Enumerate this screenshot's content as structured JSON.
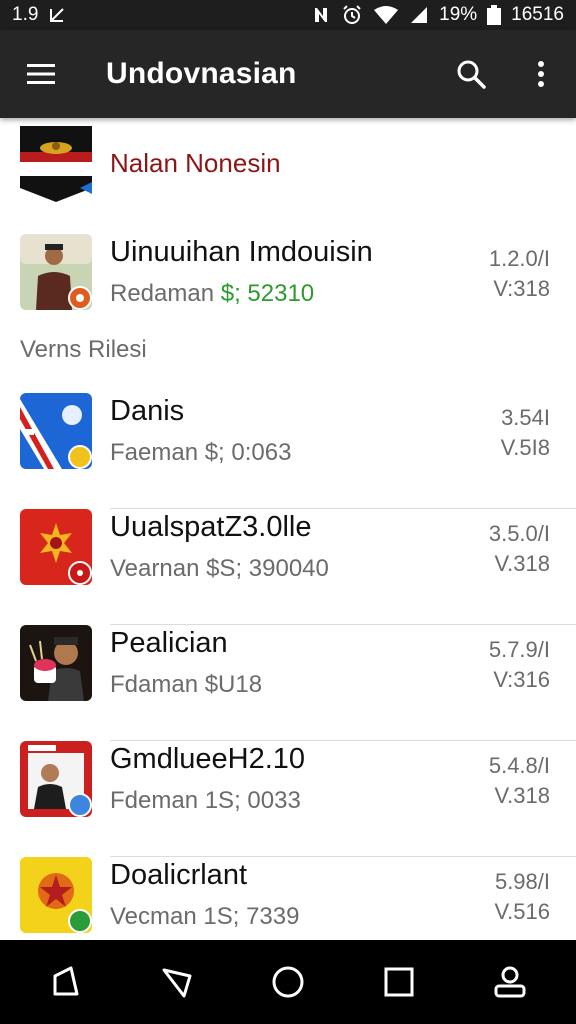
{
  "status_bar": {
    "left_text": "1.9",
    "battery_percent": "19%",
    "time": "16516"
  },
  "app_bar": {
    "title": "Undovnasian"
  },
  "featured": {
    "name": "Nalan Nonesin"
  },
  "top_app": {
    "title": "Uinuuihan Imdouisin",
    "sub_label": "Redaman",
    "sub_price": "$; 52310",
    "meta_top": "1.2.0/I",
    "meta_bottom": "V:318"
  },
  "section": {
    "label": "Verns Rilesi"
  },
  "apps": [
    {
      "title": "Danis",
      "sub": "Faeman  $; 0:063",
      "meta_top": "3.54I",
      "meta_bottom": "V.5I8"
    },
    {
      "title": "UualspatZ3.0lle",
      "sub": "Vearnan $S; 390040",
      "meta_top": "3.5.0/I",
      "meta_bottom": "V.318"
    },
    {
      "title": "Pealician",
      "sub": "Fdaman  $U18",
      "meta_top": "5.7.9/I",
      "meta_bottom": "V:316"
    },
    {
      "title": "GmdlueeH2.10",
      "sub": "Fdeman 1S; 0033",
      "meta_top": "5.4.8/I",
      "meta_bottom": "V.318"
    },
    {
      "title": "Doalicrlant",
      "sub": "Vecman 1S; 7339",
      "meta_top": "5.98/I",
      "meta_bottom": "V.516"
    }
  ],
  "colors": {
    "status_bar_bg": "#1e1e1e",
    "app_bar_bg": "#262626",
    "featured_text": "#8b1616",
    "price_green": "#2d9a2d",
    "nav_bar_bg": "#000000"
  },
  "icons": {
    "menu": "menu-icon",
    "search": "search-icon",
    "overflow": "more-vert-icon",
    "nav_back": "back-icon",
    "nav_recent_tri": "triangle-icon",
    "nav_home": "home-icon",
    "nav_square": "square-icon",
    "nav_user": "user-icon"
  }
}
